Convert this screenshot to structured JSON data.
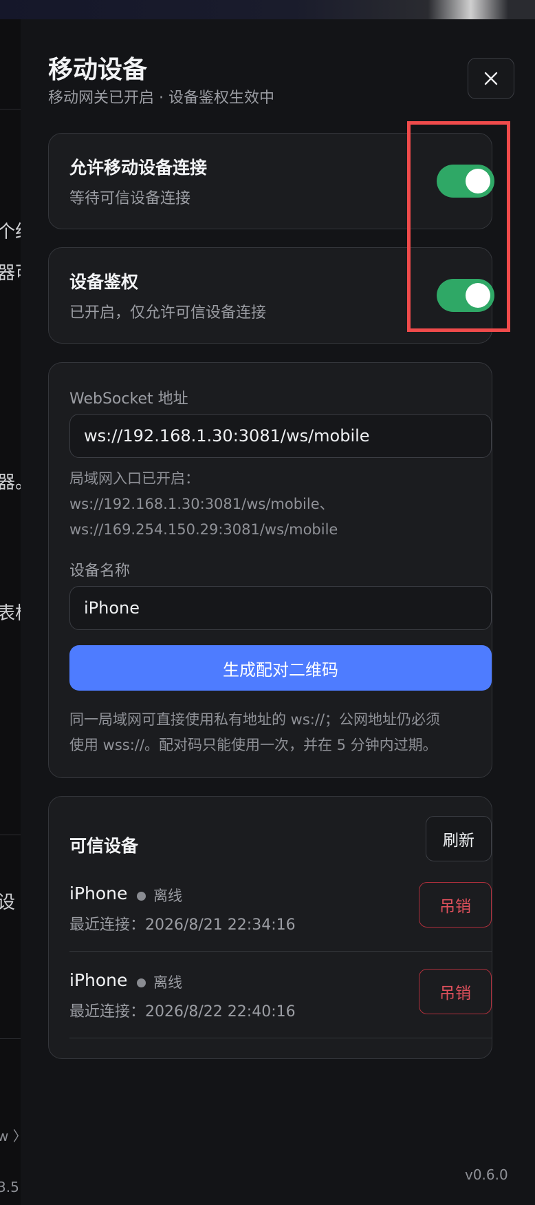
{
  "background": {
    "fragments": [
      "个红",
      "器可",
      "器。",
      "表格",
      "设",
      "w 〉",
      "3.5"
    ]
  },
  "panel": {
    "title": "移动设备",
    "subtitle": "移动网关已开启 · 设备鉴权生效中",
    "close_icon": "close-icon"
  },
  "toggles": [
    {
      "title": "允许移动设备连接",
      "description": "等待可信设备连接",
      "enabled": true
    },
    {
      "title": "设备鉴权",
      "description": "已开启，仅允许可信设备连接",
      "enabled": true
    }
  ],
  "connection": {
    "websocket_label": "WebSocket 地址",
    "websocket_value": "ws://192.168.1.30:3081/ws/mobile",
    "lan_hint_line1": "局域网入口已开启：",
    "lan_hint_line2": "ws://192.168.1.30:3081/ws/mobile、",
    "lan_hint_line3": "ws://169.254.150.29:3081/ws/mobile",
    "device_name_label": "设备名称",
    "device_name_value": "iPhone",
    "pair_button": "生成配对二维码",
    "note_line1": "同一局域网可直接使用私有地址的 ws://；公网地址仍必须",
    "note_line2": "使用 wss://。配对码只能使用一次，并在 5 分钟内过期。"
  },
  "trusted": {
    "title": "可信设备",
    "refresh_button": "刷新",
    "devices": [
      {
        "name": "iPhone",
        "status": "离线",
        "last_connected": "最近连接：2026/8/21 22:34:16",
        "revoke": "吊销"
      },
      {
        "name": "iPhone",
        "status": "离线",
        "last_connected": "最近连接：2026/8/22 22:40:16",
        "revoke": "吊销"
      }
    ]
  },
  "version": "v0.6.0",
  "colors": {
    "accent": "#4e7cff",
    "toggle_on": "#2fa866",
    "danger": "#e0505c",
    "highlight": "#f04b4b"
  }
}
